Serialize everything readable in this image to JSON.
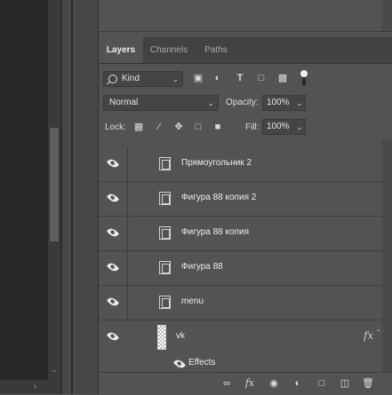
{
  "tabs": [
    {
      "label": "Layers",
      "active": true
    },
    {
      "label": "Channels",
      "active": false
    },
    {
      "label": "Paths",
      "active": false
    }
  ],
  "filter": {
    "kind_label": "Kind",
    "icons": [
      "image-filter-icon",
      "adjustment-filter-icon",
      "type-filter-icon",
      "shape-filter-icon",
      "smart-object-filter-icon",
      "filter-toggle-icon"
    ]
  },
  "blend": {
    "mode": "Normal",
    "opacity_label": "Opacity:",
    "opacity_value": "100%"
  },
  "lock": {
    "label": "Lock:",
    "icons": [
      "lock-transparent-pixels-icon",
      "lock-image-pixels-icon",
      "lock-position-icon",
      "lock-artboard-icon",
      "lock-all-icon"
    ],
    "fill_label": "Fill:",
    "fill_value": "100%"
  },
  "layers": [
    {
      "name": "Прямоугольник 2",
      "type": "shape"
    },
    {
      "name": "Фигура 88 копия 2",
      "type": "shape"
    },
    {
      "name": "Фигура 88 копия",
      "type": "shape"
    },
    {
      "name": "Фигура 88",
      "type": "shape"
    },
    {
      "name": "menu",
      "type": "shape"
    },
    {
      "name": "vk",
      "type": "image",
      "has_effects": true,
      "fx_label": "fx"
    }
  ],
  "effects_label": "Effects",
  "bottom_toolbar_icons": [
    "link-layers-icon",
    "layer-style-icon",
    "add-mask-icon",
    "adjustment-layer-icon",
    "new-group-icon",
    "new-layer-icon",
    "delete-layer-icon"
  ],
  "colors": {
    "panel_bg": "#535353",
    "tab_bar_bg": "#424242",
    "canvas_bg": "#282828"
  }
}
